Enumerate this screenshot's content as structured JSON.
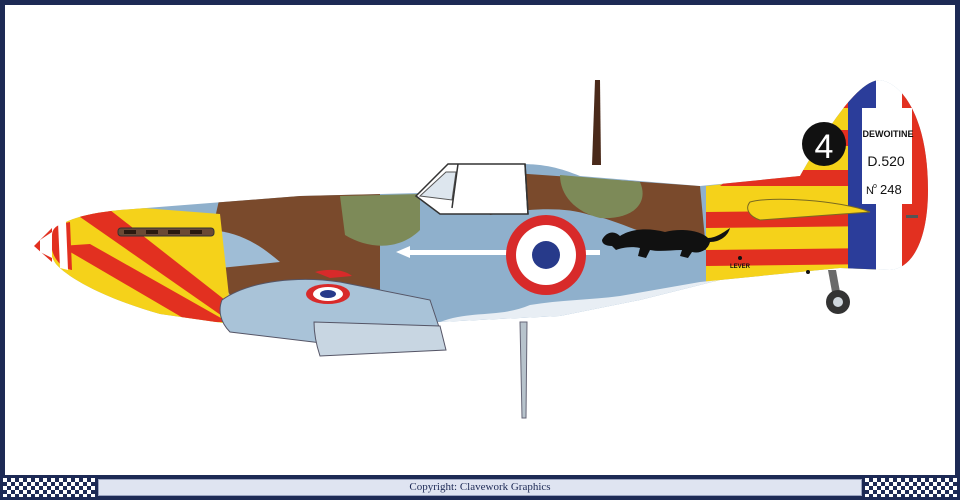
{
  "aircraft": {
    "maker": "DEWOITINE",
    "model": "D.520",
    "serial_prefix": "N",
    "serial_sup": "o",
    "serial_number": "248",
    "tail_number": "4",
    "lever_label": "LEVER"
  },
  "footer": {
    "copyright": "Copyright: Clavework Graphics"
  },
  "colors": {
    "frame": "#1d2a55",
    "yellow": "#f5d21a",
    "red": "#e23020",
    "blue_grey": "#8fb0cc",
    "brown": "#7a4a2c",
    "green": "#7d8a58",
    "roundel_blue": "#273a8a",
    "roundel_red": "#d82a2a",
    "tricolour_blue": "#2b3d9a"
  },
  "icons": [
    "panther-emblem-icon",
    "roundel-icon",
    "spinner-icon",
    "wheel-icon"
  ]
}
